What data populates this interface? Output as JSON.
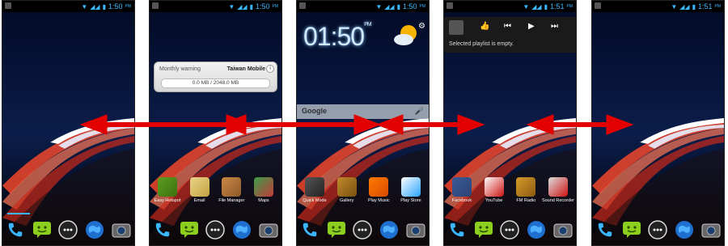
{
  "status": {
    "times": [
      "1:50",
      "1:50",
      "1:50",
      "1:51",
      "1:51"
    ],
    "ampm": "PM"
  },
  "screen2": {
    "warning_label": "Monthly warning",
    "carrier": "Taiwan Mobile",
    "info_glyph": "i",
    "usage": "0.0 MB / 2048.0 MB",
    "apps": [
      "Easy Hotspot",
      "Email",
      "File Manager",
      "Maps"
    ]
  },
  "screen3": {
    "clock": "01:50",
    "clock_suffix": "PM",
    "search_label": "Google",
    "apps": [
      "Quick Mode",
      "Gallery",
      "Play Music",
      "Play Store"
    ]
  },
  "screen4": {
    "playlist_message": "Selected playlist is empty.",
    "apps": [
      "Facebook",
      "YouTube",
      "FM Radio",
      "Sound Recorder"
    ]
  },
  "dock": [
    "phone-icon",
    "messaging-icon",
    "apps-drawer-icon",
    "browser-icon",
    "camera-icon"
  ],
  "colors": {
    "status_accent": "#3bb7ff",
    "arrow": "#e30000",
    "background": "#0a1226"
  }
}
